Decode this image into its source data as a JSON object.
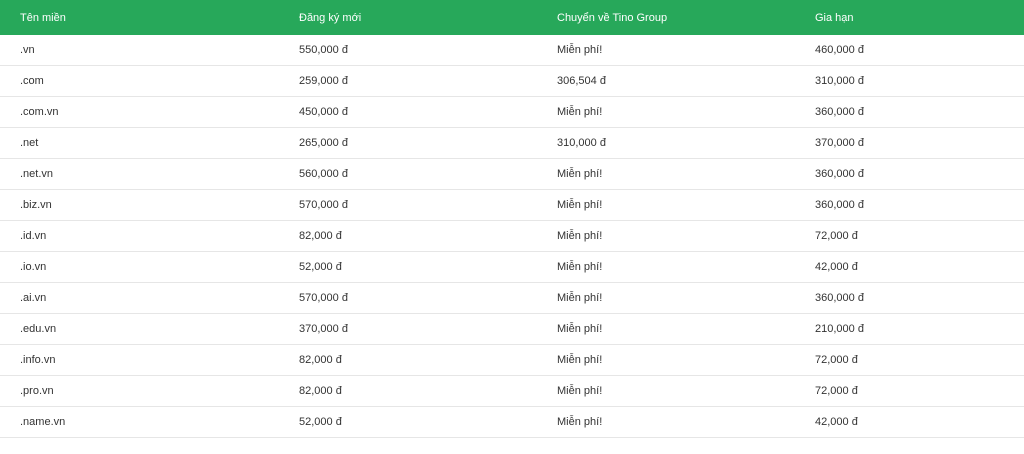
{
  "table": {
    "headers": {
      "domain": "Tên miền",
      "register": "Đăng ký mới",
      "transfer": "Chuyển về Tino Group",
      "renew": "Gia hạn"
    },
    "rows": [
      {
        "domain": ".vn",
        "register": "550,000 đ",
        "transfer": "Miễn phí!",
        "renew": "460,000 đ"
      },
      {
        "domain": ".com",
        "register": "259,000 đ",
        "transfer": "306,504 đ",
        "renew": "310,000 đ"
      },
      {
        "domain": ".com.vn",
        "register": "450,000 đ",
        "transfer": "Miễn phí!",
        "renew": "360,000 đ"
      },
      {
        "domain": ".net",
        "register": "265,000 đ",
        "transfer": "310,000 đ",
        "renew": "370,000 đ"
      },
      {
        "domain": ".net.vn",
        "register": "560,000 đ",
        "transfer": "Miễn phí!",
        "renew": "360,000 đ"
      },
      {
        "domain": ".biz.vn",
        "register": "570,000 đ",
        "transfer": "Miễn phí!",
        "renew": "360,000 đ"
      },
      {
        "domain": ".id.vn",
        "register": "82,000 đ",
        "transfer": "Miễn phí!",
        "renew": "72,000 đ"
      },
      {
        "domain": ".io.vn",
        "register": "52,000 đ",
        "transfer": "Miễn phí!",
        "renew": "42,000 đ"
      },
      {
        "domain": ".ai.vn",
        "register": "570,000 đ",
        "transfer": "Miễn phí!",
        "renew": "360,000 đ"
      },
      {
        "domain": ".edu.vn",
        "register": "370,000 đ",
        "transfer": "Miễn phí!",
        "renew": "210,000 đ"
      },
      {
        "domain": ".info.vn",
        "register": "82,000 đ",
        "transfer": "Miễn phí!",
        "renew": "72,000 đ"
      },
      {
        "domain": ".pro.vn",
        "register": "82,000 đ",
        "transfer": "Miễn phí!",
        "renew": "72,000 đ"
      },
      {
        "domain": ".name.vn",
        "register": "52,000 đ",
        "transfer": "Miễn phí!",
        "renew": "42,000 đ"
      }
    ]
  },
  "colors": {
    "header_background": "#27a85a",
    "header_text": "#ffffff",
    "row_text": "#333333",
    "row_divider": "#e6e6e6"
  }
}
